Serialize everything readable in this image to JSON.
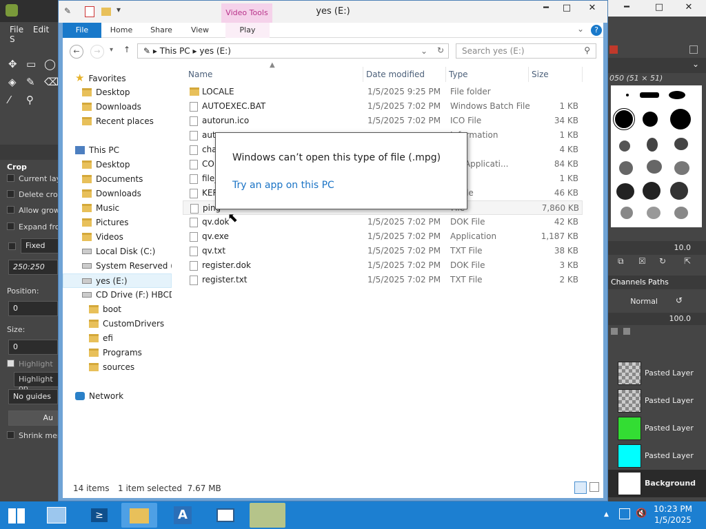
{
  "gimp_left": {
    "menu": [
      "File",
      "Edit",
      "S"
    ],
    "tool_title": "Crop",
    "options": [
      "Current lay",
      "Delete crop",
      "Allow grow",
      "Expand fro"
    ],
    "fixed_label": "Fixed",
    "aspect_value": "250:250",
    "position_label": "Position:",
    "position_value": "0",
    "size_label": "Size:",
    "size_value": "0",
    "highlight_label": "Highlight",
    "highlight_opacity": "Highlight op",
    "guides_value": "No guides",
    "auto_label": "Au",
    "shrink_label": "Shrink mer"
  },
  "gimp_right": {
    "brush_label": "050 (51 × 51)",
    "spacing_value": "10.0",
    "tabs": [
      "Channels",
      "Paths"
    ],
    "mode_value": "Normal",
    "opacity_value": "100.0",
    "layers": [
      {
        "name": "Pasted Layer",
        "fill": "#cccccc"
      },
      {
        "name": "Pasted Layer",
        "fill": "#cccccc"
      },
      {
        "name": "Pasted Layer",
        "fill": "#33dd33"
      },
      {
        "name": "Pasted Layer",
        "fill": "#00ffff"
      },
      {
        "name": "Background",
        "fill": "#ffffff"
      }
    ]
  },
  "explorer": {
    "title": "yes (E:)",
    "context_tab": "Video Tools",
    "ribbon_tabs": [
      "File",
      "Home",
      "Share",
      "View",
      "Play"
    ],
    "address": {
      "segments": [
        "This PC",
        "yes (E:)"
      ]
    },
    "search_placeholder": "Search yes (E:)",
    "nav": {
      "favorites": "Favorites",
      "fav_items": [
        "Desktop",
        "Downloads",
        "Recent places"
      ],
      "this_pc": "This PC",
      "pc_items": [
        "Desktop",
        "Documents",
        "Downloads",
        "Music",
        "Pictures",
        "Videos",
        "Local Disk (C:)",
        "System Reserved (D:",
        "yes (E:)",
        "CD Drive (F:) HBCD_"
      ],
      "cd_items": [
        "boot",
        "CustomDrivers",
        "efi",
        "Programs",
        "sources"
      ],
      "network": "Network"
    },
    "columns": [
      "Name",
      "Date modified",
      "Type",
      "Size"
    ],
    "files": [
      {
        "name": "LOCALE",
        "date": "1/5/2025 9:25 PM",
        "type": "File folder",
        "size": "",
        "folder": true
      },
      {
        "name": "AUTOEXEC.BAT",
        "date": "1/5/2025 7:02 PM",
        "type": "Windows Batch File",
        "size": "1 KB"
      },
      {
        "name": "autorun.ico",
        "date": "1/5/2025 7:02 PM",
        "type": "ICO File",
        "size": "34 KB"
      },
      {
        "name": "auto",
        "date": "",
        "type": "Information",
        "size": "1 KB"
      },
      {
        "name": "char",
        "date": "",
        "type": "ile",
        "size": "4 KB"
      },
      {
        "name": "COM",
        "date": "",
        "type": "OS Applicati...",
        "size": "84 KB"
      },
      {
        "name": "file_i",
        "date": "",
        "type": "le",
        "size": "1 KB"
      },
      {
        "name": "KERN",
        "date": "",
        "type": "m file",
        "size": "46 KB"
      },
      {
        "name": "ping",
        "date": "",
        "type": "File",
        "size": "7,860 KB",
        "selected": true
      },
      {
        "name": "qv.dok",
        "date": "1/5/2025 7:02 PM",
        "type": "DOK File",
        "size": "42 KB"
      },
      {
        "name": "qv.exe",
        "date": "1/5/2025 7:02 PM",
        "type": "Application",
        "size": "1,187 KB"
      },
      {
        "name": "qv.txt",
        "date": "1/5/2025 7:02 PM",
        "type": "TXT File",
        "size": "38 KB"
      },
      {
        "name": "register.dok",
        "date": "1/5/2025 7:02 PM",
        "type": "DOK File",
        "size": "3 KB"
      },
      {
        "name": "register.txt",
        "date": "1/5/2025 7:02 PM",
        "type": "TXT File",
        "size": "2 KB"
      }
    ],
    "status": {
      "count": "14 items",
      "selection": "1 item selected  7.67 MB"
    }
  },
  "popup": {
    "message": "Windows can’t open this type of file (.mpg)",
    "link": "Try an app on this PC"
  },
  "taskbar": {
    "time": "10:23 PM",
    "date": "1/5/2025"
  }
}
